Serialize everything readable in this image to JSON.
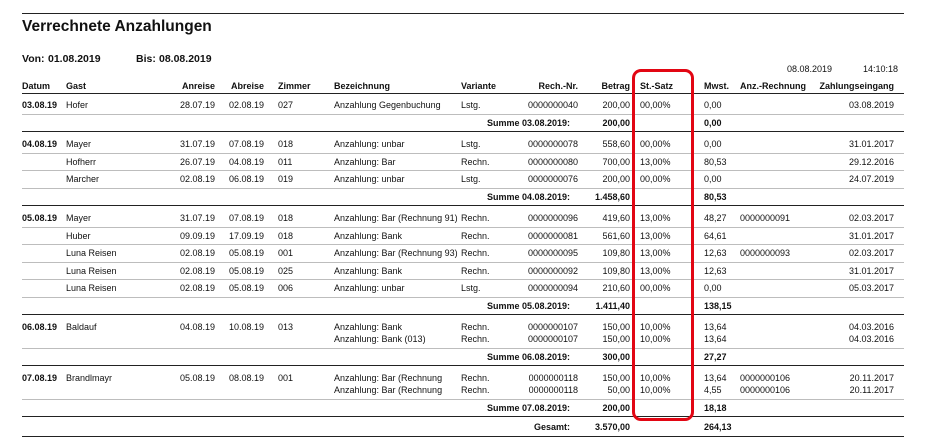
{
  "report": {
    "title": "Verrechnete Anzahlungen",
    "von_label": "Von:",
    "von_value": "01.08.2019",
    "bis_label": "Bis:",
    "bis_value": "08.08.2019",
    "print_date": "08.08.2019",
    "print_time": "14:10:18"
  },
  "columns": [
    "Datum",
    "Gast",
    "Anreise",
    "Abreise",
    "Zimmer",
    "Bezeichnung",
    "Variante",
    "Rech.-Nr.",
    "Betrag",
    "St.-Satz",
    "Mwst.",
    "Anz.-Rechnung",
    "Zahlungseingang"
  ],
  "groups": [
    {
      "date": "03.08.19",
      "rows": [
        {
          "gast": "Hofer",
          "anreise": "28.07.19",
          "abreise": "02.08.19",
          "zimmer": "027",
          "lines": [
            {
              "bez": "Anzahlung Gegenbuchung",
              "var": "Lstg.",
              "nr": "0000000040",
              "betrag": "200,00",
              "satz": "00,00%",
              "mwst": "0,00",
              "anz": "",
              "zahl": "03.08.2019"
            }
          ]
        }
      ],
      "sum_label": "Summe 03.08.2019:",
      "sum_betrag": "200,00",
      "sum_mwst": "0,00"
    },
    {
      "date": "04.08.19",
      "rows": [
        {
          "gast": "Mayer",
          "anreise": "31.07.19",
          "abreise": "07.08.19",
          "zimmer": "018",
          "lines": [
            {
              "bez": "Anzahlung: unbar",
              "var": "Lstg.",
              "nr": "0000000078",
              "betrag": "558,60",
              "satz": "00,00%",
              "mwst": "0,00",
              "anz": "",
              "zahl": "31.01.2017"
            }
          ]
        },
        {
          "gast": "Hofherr",
          "anreise": "26.07.19",
          "abreise": "04.08.19",
          "zimmer": "011",
          "lines": [
            {
              "bez": "Anzahlung: Bar",
              "var": "Rechn.",
              "nr": "0000000080",
              "betrag": "700,00",
              "satz": "13,00%",
              "mwst": "80,53",
              "anz": "",
              "zahl": "29.12.2016"
            }
          ]
        },
        {
          "gast": "Marcher",
          "anreise": "02.08.19",
          "abreise": "06.08.19",
          "zimmer": "019",
          "lines": [
            {
              "bez": "Anzahlung: unbar",
              "var": "Lstg.",
              "nr": "0000000076",
              "betrag": "200,00",
              "satz": "00,00%",
              "mwst": "0,00",
              "anz": "",
              "zahl": "24.07.2019"
            }
          ]
        }
      ],
      "sum_label": "Summe 04.08.2019:",
      "sum_betrag": "1.458,60",
      "sum_mwst": "80,53"
    },
    {
      "date": "05.08.19",
      "rows": [
        {
          "gast": "Mayer",
          "anreise": "31.07.19",
          "abreise": "07.08.19",
          "zimmer": "018",
          "lines": [
            {
              "bez": "Anzahlung: Bar (Rechnung 91)",
              "var": "Rechn.",
              "nr": "0000000096",
              "betrag": "419,60",
              "satz": "13,00%",
              "mwst": "48,27",
              "anz": "0000000091",
              "zahl": "02.03.2017"
            }
          ]
        },
        {
          "gast": "Huber",
          "anreise": "09.09.19",
          "abreise": "17.09.19",
          "zimmer": "018",
          "lines": [
            {
              "bez": "Anzahlung: Bank",
              "var": "Rechn.",
              "nr": "0000000081",
              "betrag": "561,60",
              "satz": "13,00%",
              "mwst": "64,61",
              "anz": "",
              "zahl": "31.01.2017"
            }
          ]
        },
        {
          "gast": "Luna Reisen",
          "anreise": "02.08.19",
          "abreise": "05.08.19",
          "zimmer": "001",
          "lines": [
            {
              "bez": "Anzahlung: Bar (Rechnung 93)",
              "var": "Rechn.",
              "nr": "0000000095",
              "betrag": "109,80",
              "satz": "13,00%",
              "mwst": "12,63",
              "anz": "0000000093",
              "zahl": "02.03.2017"
            }
          ]
        },
        {
          "gast": "Luna Reisen",
          "anreise": "02.08.19",
          "abreise": "05.08.19",
          "zimmer": "025",
          "lines": [
            {
              "bez": "Anzahlung: Bank",
              "var": "Rechn.",
              "nr": "0000000092",
              "betrag": "109,80",
              "satz": "13,00%",
              "mwst": "12,63",
              "anz": "",
              "zahl": "31.01.2017"
            }
          ]
        },
        {
          "gast": "Luna Reisen",
          "anreise": "02.08.19",
          "abreise": "05.08.19",
          "zimmer": "006",
          "lines": [
            {
              "bez": "Anzahlung: unbar",
              "var": "Lstg.",
              "nr": "0000000094",
              "betrag": "210,60",
              "satz": "00,00%",
              "mwst": "0,00",
              "anz": "",
              "zahl": "05.03.2017"
            }
          ]
        }
      ],
      "sum_label": "Summe 05.08.2019:",
      "sum_betrag": "1.411,40",
      "sum_mwst": "138,15"
    },
    {
      "date": "06.08.19",
      "rows": [
        {
          "gast": "Baldauf",
          "anreise": "04.08.19",
          "abreise": "10.08.19",
          "zimmer": "013",
          "lines": [
            {
              "bez": "Anzahlung: Bank",
              "var": "Rechn.",
              "nr": "0000000107",
              "betrag": "150,00",
              "satz": "10,00%",
              "mwst": "13,64",
              "anz": "",
              "zahl": "04.03.2016"
            },
            {
              "bez": "Anzahlung: Bank (013)",
              "var": "Rechn.",
              "nr": "0000000107",
              "betrag": "150,00",
              "satz": "10,00%",
              "mwst": "13,64",
              "anz": "",
              "zahl": "04.03.2016"
            }
          ]
        }
      ],
      "sum_label": "Summe 06.08.2019:",
      "sum_betrag": "300,00",
      "sum_mwst": "27,27"
    },
    {
      "date": "07.08.19",
      "rows": [
        {
          "gast": "Brandlmayr",
          "anreise": "05.08.19",
          "abreise": "08.08.19",
          "zimmer": "001",
          "lines": [
            {
              "bez": "Anzahlung: Bar (Rechnung",
              "var": "Rechn.",
              "nr": "0000000118",
              "betrag": "150,00",
              "satz": "10,00%",
              "mwst": "13,64",
              "anz": "0000000106",
              "zahl": "20.11.2017"
            },
            {
              "bez": "Anzahlung: Bar (Rechnung",
              "var": "Rechn.",
              "nr": "0000000118",
              "betrag": "50,00",
              "satz": "10,00%",
              "mwst": "4,55",
              "anz": "0000000106",
              "zahl": "20.11.2017"
            }
          ]
        }
      ],
      "sum_label": "Summe 07.08.2019:",
      "sum_betrag": "200,00",
      "sum_mwst": "18,18"
    }
  ],
  "total": {
    "label": "Gesamt:",
    "betrag": "3.570,00",
    "mwst": "264,13"
  },
  "annotation": {
    "highlight_color": "#e20613",
    "highlighted_column": "St.-Satz"
  }
}
